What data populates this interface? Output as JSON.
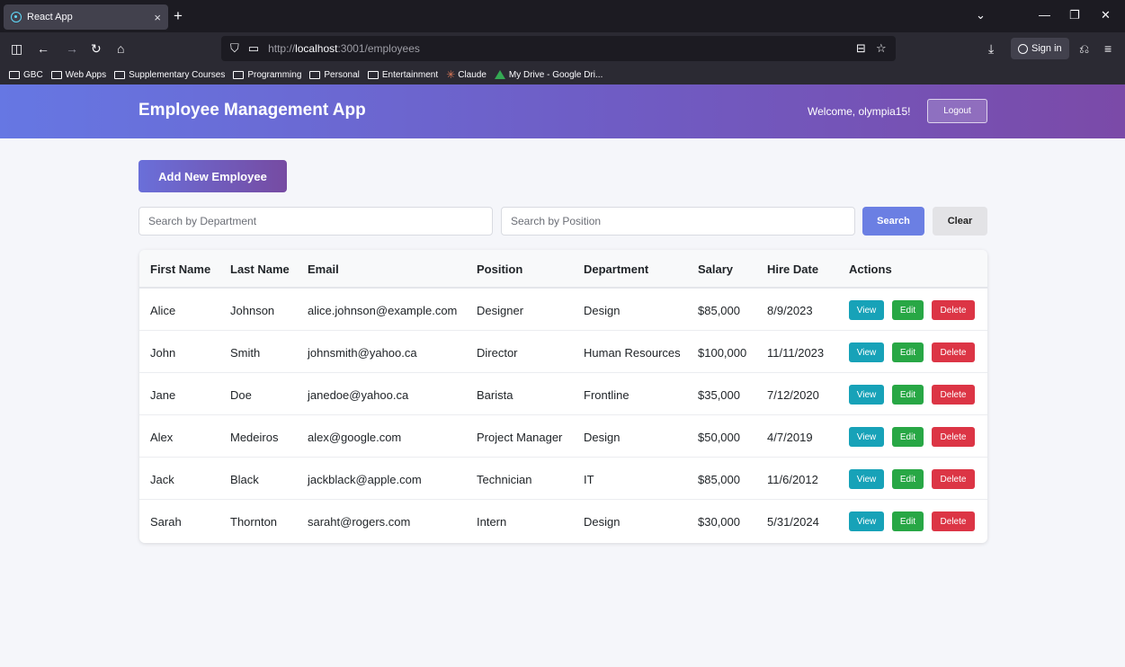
{
  "browser": {
    "tab_title": "React App",
    "tab_close": "×",
    "new_tab": "+",
    "url_prefix": "http://",
    "url_host": "localhost",
    "url_path": ":3001/employees",
    "sign_in": "Sign in",
    "bookmarks": [
      "GBC",
      "Web Apps",
      "Supplementary Courses",
      "Programming",
      "Personal",
      "Entertainment",
      "Claude",
      "My Drive - Google Dri..."
    ]
  },
  "header": {
    "title": "Employee Management App",
    "welcome": "Welcome, olympia15!",
    "logout_label": "Logout"
  },
  "toolbar": {
    "add_label": "Add New Employee",
    "search_department_placeholder": "Search by Department",
    "search_position_placeholder": "Search by Position",
    "search_label": "Search",
    "clear_label": "Clear"
  },
  "table": {
    "columns": [
      "First Name",
      "Last Name",
      "Email",
      "Position",
      "Department",
      "Salary",
      "Hire Date",
      "Actions"
    ],
    "action_labels": {
      "view": "View",
      "edit": "Edit",
      "delete": "Delete"
    },
    "rows": [
      {
        "first": "Alice",
        "last": "Johnson",
        "email": "alice.johnson@example.com",
        "position": "Designer",
        "department": "Design",
        "salary": "$85,000",
        "hire_date": "8/9/2023"
      },
      {
        "first": "John",
        "last": "Smith",
        "email": "johnsmith@yahoo.ca",
        "position": "Director",
        "department": "Human Resources",
        "salary": "$100,000",
        "hire_date": "11/11/2023"
      },
      {
        "first": "Jane",
        "last": "Doe",
        "email": "janedoe@yahoo.ca",
        "position": "Barista",
        "department": "Frontline",
        "salary": "$35,000",
        "hire_date": "7/12/2020"
      },
      {
        "first": "Alex",
        "last": "Medeiros",
        "email": "alex@google.com",
        "position": "Project Manager",
        "department": "Design",
        "salary": "$50,000",
        "hire_date": "4/7/2019"
      },
      {
        "first": "Jack",
        "last": "Black",
        "email": "jackblack@apple.com",
        "position": "Technician",
        "department": "IT",
        "salary": "$85,000",
        "hire_date": "11/6/2012"
      },
      {
        "first": "Sarah",
        "last": "Thornton",
        "email": "saraht@rogers.com",
        "position": "Intern",
        "department": "Design",
        "salary": "$30,000",
        "hire_date": "5/31/2024"
      }
    ]
  },
  "colors": {
    "header_gradient_start": "#6677e3",
    "header_gradient_end": "#7b4aa8",
    "view": "#17a2b8",
    "edit": "#28a745",
    "delete": "#dc3545",
    "search": "#6b7fe3"
  }
}
